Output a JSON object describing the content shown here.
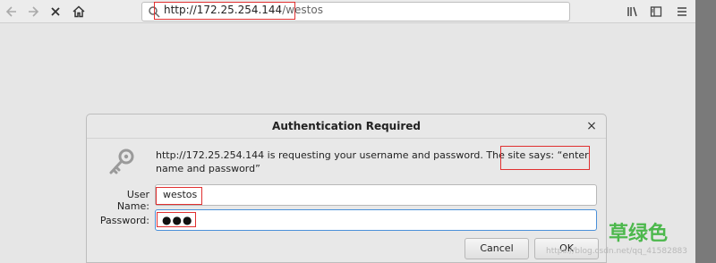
{
  "browser": {
    "url_host": "http://172.25.254.144",
    "url_path": "/westos"
  },
  "dialog": {
    "title": "Authentication Required",
    "close": "×",
    "message": "http://172.25.254.144 is requesting your username and password. The site says: “enter name and password”",
    "username_label": "User Name:",
    "username_value": "westos",
    "password_label": "Password:",
    "password_mask": "●●●",
    "cancel_label": "Cancel",
    "ok_label": "OK"
  },
  "watermark": {
    "logo": "草绿色",
    "url": "https://blog.csdn.net/qq_41582883"
  },
  "colors": {
    "highlight": "#e03030",
    "focus": "#4a90d9",
    "watermark": "#4cb84c"
  }
}
